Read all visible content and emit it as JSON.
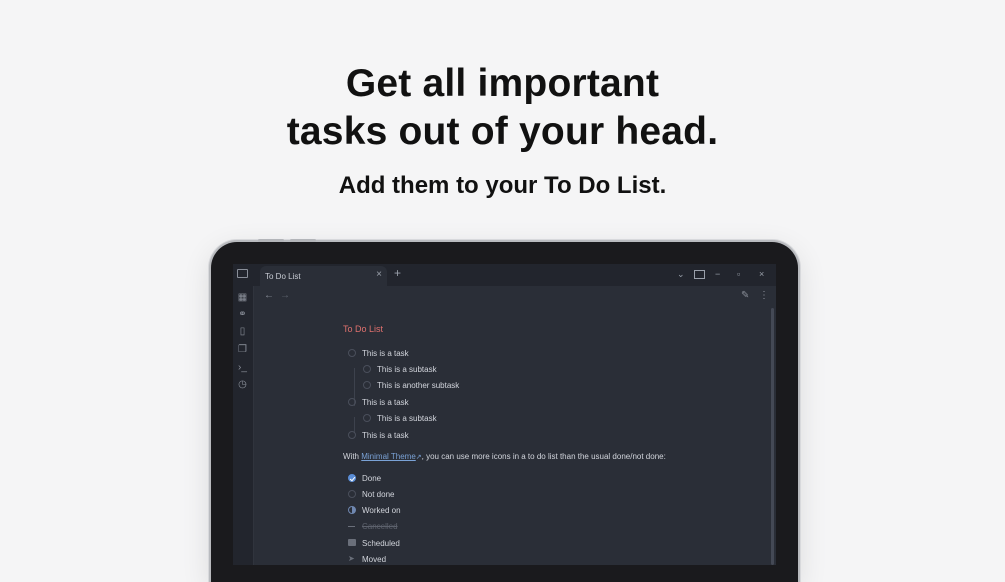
{
  "hero": {
    "headline_line1": "Get all important",
    "headline_line2": "tasks out of your head.",
    "subheadline": "Add them to your To Do List."
  },
  "app": {
    "tab_title": "To Do List",
    "note_title": "To Do List",
    "tasks": [
      {
        "label": "This is a task"
      },
      {
        "label": "This is a subtask"
      },
      {
        "label": "This is another subtask"
      },
      {
        "label": "This is a task"
      },
      {
        "label": "This is a subtask"
      },
      {
        "label": "This is a task"
      }
    ],
    "paragraph": {
      "prefix": "With ",
      "link": "Minimal Theme",
      "suffix": ", you can use more icons in a to do list than the usual done/not done:"
    },
    "states": [
      {
        "label": "Done"
      },
      {
        "label": "Not done"
      },
      {
        "label": "Worked on"
      },
      {
        "label": "Cancelled"
      },
      {
        "label": "Scheduled"
      },
      {
        "label": "Moved"
      }
    ],
    "colors": {
      "accent_title": "#e0716e",
      "link": "#7aa2d6",
      "done": "#5a8dd6",
      "background": "#2a2e37"
    }
  }
}
